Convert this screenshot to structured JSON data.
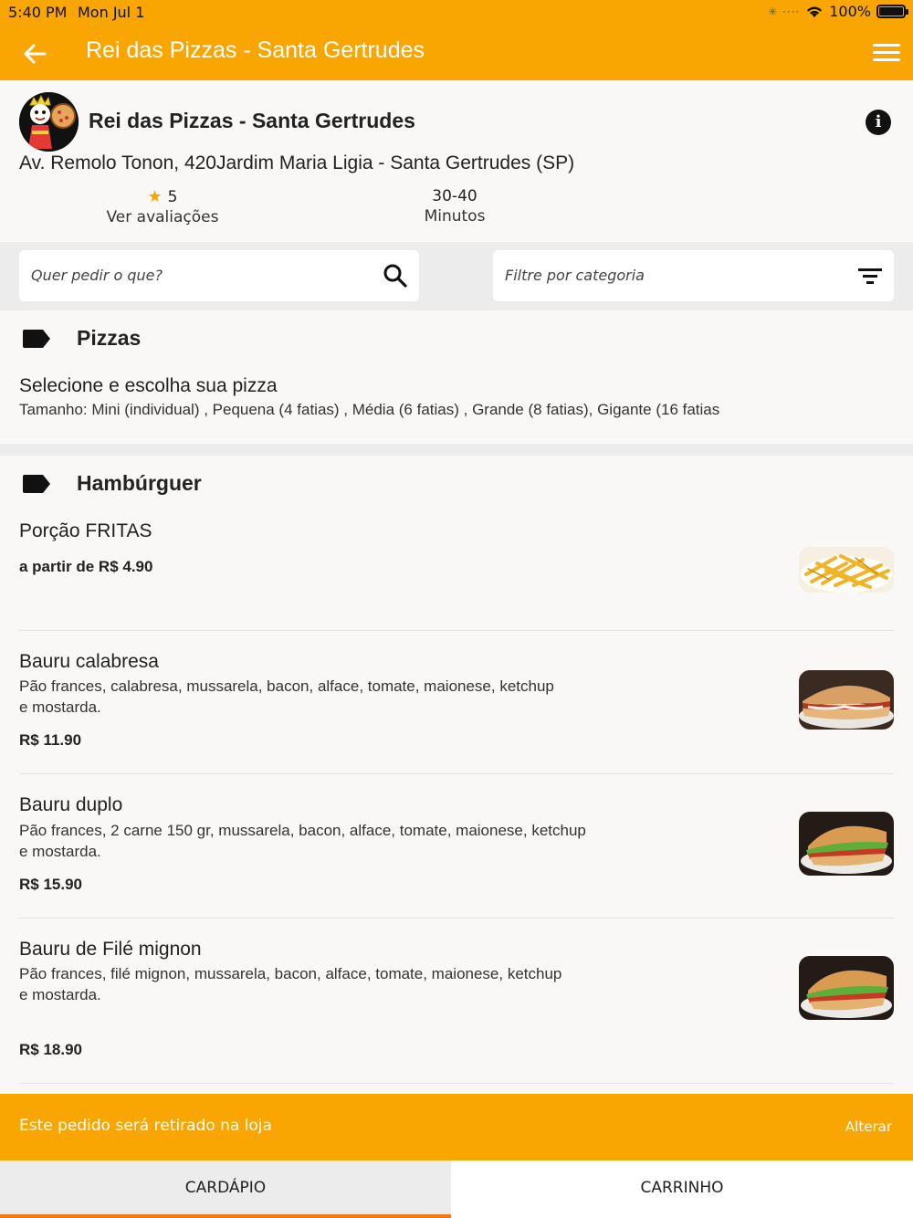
{
  "status": {
    "time": "5:40 PM",
    "date": "Mon Jul 1",
    "battery": "100%"
  },
  "appbar": {
    "title": "Rei das Pizzas - Santa Gertrudes",
    "back_icon": "arrow-left-icon",
    "menu_icon": "hamburger-menu-icon"
  },
  "store": {
    "name": "Rei das Pizzas - Santa Gertrudes",
    "address": "Av. Remolo Tonon, 420Jardim Maria Ligia - Santa Gertrudes  (SP)",
    "rating_value": "5",
    "rating_label": "Ver avaliações",
    "time_value": "30-40",
    "time_label": "Minutos"
  },
  "filters": {
    "search_placeholder": "Quer pedir o que?",
    "category_placeholder": "Filtre por categoria"
  },
  "sections": [
    {
      "title": "Pizzas",
      "items": [
        {
          "name": "Selecione e escolha sua pizza",
          "desc": "Tamanho: Mini (individual)  , Pequena (4 fatias)  , Média (6 fatias)  , Grande (8 fatias), Gigante (16 fatias"
        }
      ]
    },
    {
      "title": "Hambúrguer",
      "items": [
        {
          "name": "Porção FRITAS",
          "price": "a partir de  R$ 4.90"
        },
        {
          "name": "Bauru calabresa",
          "desc1": "Pão frances, calabresa, mussarela, bacon, alface, tomate, maionese, ketchup",
          "desc2": "e mostarda.",
          "price": "R$ 11.90"
        },
        {
          "name": "Bauru duplo",
          "desc1": "Pão frances,  2 carne 150 gr, mussarela, bacon, alface, tomate, maionese, ketchup",
          "desc2": "e mostarda.",
          "price": "R$ 15.90"
        },
        {
          "name": "Bauru de Filé mignon",
          "desc1": "Pão frances,  filé mignon, mussarela, bacon, alface, tomate, maionese, ketchup",
          "desc2": "e mostarda.",
          "price": "R$ 18.90"
        }
      ]
    }
  ],
  "pickup": {
    "text": "Este pedido será retirado na loja",
    "action": "Alterar"
  },
  "tabs": [
    {
      "label": "CARDÁPIO"
    },
    {
      "label": "CARRINHO"
    }
  ],
  "colors": {
    "primary": "#f9a602",
    "tab_indicator": "#f07a10"
  }
}
